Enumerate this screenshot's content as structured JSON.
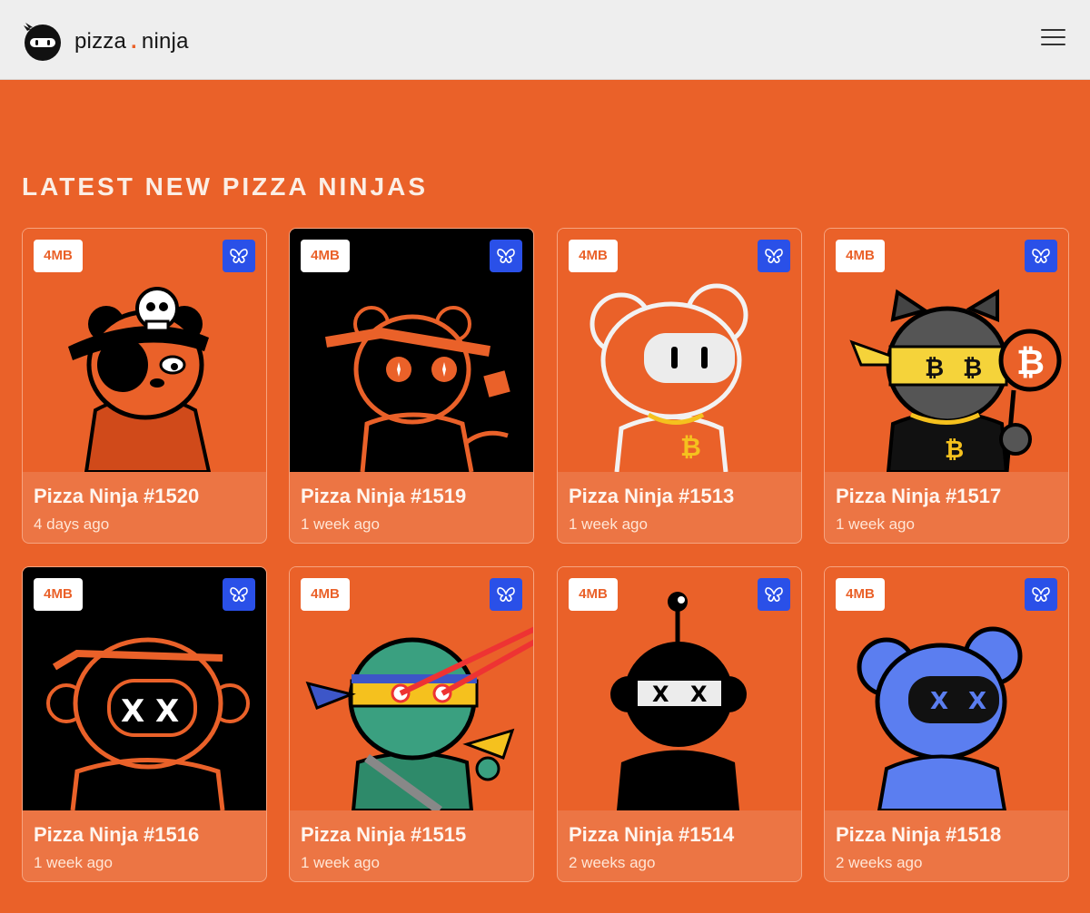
{
  "header": {
    "logo_left": "pizza",
    "logo_dot": ".",
    "logo_right": "ninja",
    "menu_icon": "hamburger-icon"
  },
  "section": {
    "title": "LATEST NEW PIZZA NINJAS"
  },
  "cards": [
    {
      "badge": "4MB",
      "name": "Pizza Ninja #1520",
      "time": "4 days ago"
    },
    {
      "badge": "4MB",
      "name": "Pizza Ninja #1519",
      "time": "1 week ago"
    },
    {
      "badge": "4MB",
      "name": "Pizza Ninja #1513",
      "time": "1 week ago"
    },
    {
      "badge": "4MB",
      "name": "Pizza Ninja #1517",
      "time": "1 week ago"
    },
    {
      "badge": "4MB",
      "name": "Pizza Ninja #1516",
      "time": "1 week ago"
    },
    {
      "badge": "4MB",
      "name": "Pizza Ninja #1515",
      "time": "1 week ago"
    },
    {
      "badge": "4MB",
      "name": "Pizza Ninja #1514",
      "time": "2 weeks ago"
    },
    {
      "badge": "4MB",
      "name": "Pizza Ninja #1518",
      "time": "2 weeks ago"
    }
  ],
  "colors": {
    "accent": "#ea6129",
    "header_bg": "#eeeeee",
    "fav_blue": "#2a50e8"
  }
}
